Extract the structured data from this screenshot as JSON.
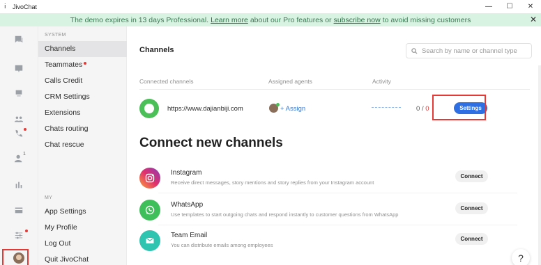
{
  "window": {
    "title": "JivoChat",
    "minimize": "—",
    "maximize": "☐",
    "close": "✕"
  },
  "banner": {
    "text_before": "The demo expires in 13 days Professional.",
    "link1": "Learn more",
    "text_middle": "about our Pro features or",
    "link2": "subscribe now",
    "text_after": "to avoid missing customers",
    "close": "✕"
  },
  "rail": {
    "items": [
      "chats-icon",
      "inbox-icon",
      "team-icon",
      "calls-icon",
      "visitors-icon",
      "reports-icon",
      "billing-icon",
      "settings-icon"
    ],
    "visitors_badge": "1"
  },
  "sidebar": {
    "system_label": "SYSTEM",
    "items": [
      {
        "label": "Channels"
      },
      {
        "label": "Teammates"
      },
      {
        "label": "Calls Credit"
      },
      {
        "label": "CRM Settings"
      },
      {
        "label": "Extensions"
      },
      {
        "label": "Chats routing"
      },
      {
        "label": "Chat rescue"
      }
    ],
    "my_label": "MY",
    "my_items": [
      {
        "label": "App Settings"
      },
      {
        "label": "My Profile"
      },
      {
        "label": "Log Out"
      },
      {
        "label": "Quit JivoChat"
      }
    ]
  },
  "main": {
    "title": "Channels",
    "search_placeholder": "Search by name or channel type",
    "columns": {
      "connected": "Connected channels",
      "agents": "Assigned agents",
      "activity": "Activity"
    },
    "connected": {
      "url": "https://www.dajianbiji.com",
      "assign": "+ Assign",
      "activity_done": "0",
      "activity_sep": "/",
      "activity_total": "0",
      "settings": "Settings"
    },
    "connect_title": "Connect new channels",
    "new_channels": [
      {
        "name": "Instagram",
        "desc": "Receive direct messages, story mentions and story replies from your Instagram account",
        "button": "Connect"
      },
      {
        "name": "WhatsApp",
        "desc": "Use templates to start outgoing chats and respond instantly to customer questions from WhatsApp",
        "button": "Connect"
      },
      {
        "name": "Team Email",
        "desc": "You can distribute emails among employees",
        "button": "Connect"
      }
    ],
    "help": "?"
  },
  "colors": {
    "banner_bg": "#d8f3e2",
    "accent_blue": "#2f6fe4",
    "highlight_red": "#e53935",
    "channel_green": "#4bbf58"
  }
}
